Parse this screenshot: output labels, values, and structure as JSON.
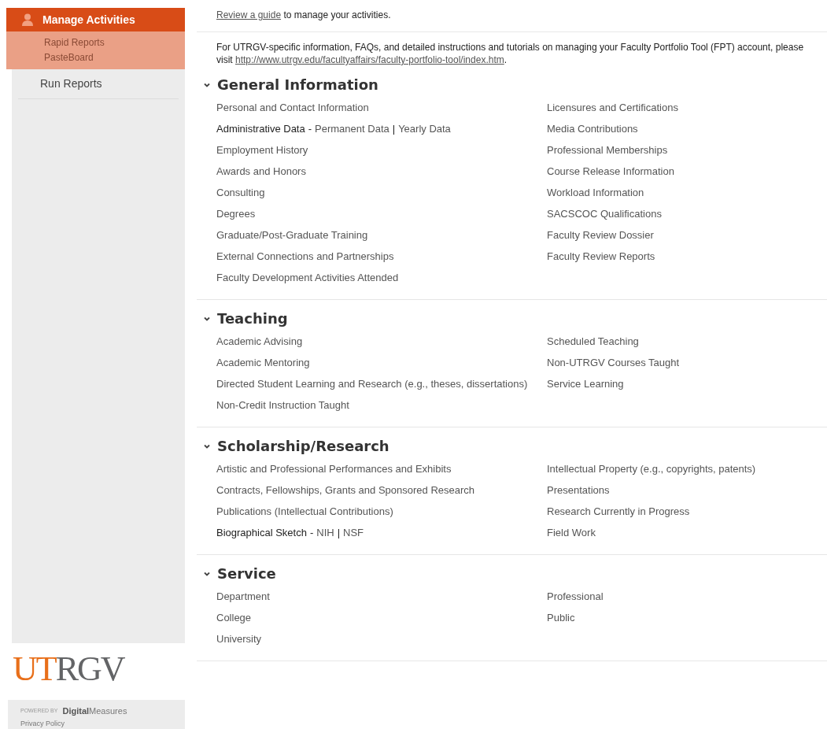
{
  "sidebar": {
    "items": [
      {
        "label": "Manage Activities",
        "selected": true,
        "children": [
          {
            "label": "Rapid Reports"
          },
          {
            "label": "PasteBoard"
          }
        ]
      },
      {
        "label": "Run Reports",
        "selected": false
      }
    ],
    "logo": {
      "primary": "UT",
      "secondary": "RGV"
    },
    "powered_by": {
      "prefix": "POWERED BY",
      "brand_bold": "Digital",
      "brand_light": "Measures"
    },
    "privacy_link": "Privacy Policy"
  },
  "intro": {
    "link": "Review a guide",
    "text": " to manage your activities."
  },
  "notice": {
    "text": "For UTRGV-specific information, FAQs, and detailed instructions and tutorials on managing your Faculty Portfolio Tool (FPT) account, please visit ",
    "link": "http://www.utrgv.edu/facultyaffairs/faculty-portfolio-tool/index.htm",
    "end": "."
  },
  "sections": [
    {
      "title": "General Information",
      "expanded": true,
      "left": [
        {
          "kind": "link",
          "label": "Personal and Contact Information"
        },
        {
          "kind": "split",
          "label": "Administrative Data",
          "dash": "-",
          "links": [
            "Permanent Data",
            "Yearly Data"
          ],
          "divider": "|"
        },
        {
          "kind": "link",
          "label": "Employment History"
        },
        {
          "kind": "link",
          "label": "Awards and Honors"
        },
        {
          "kind": "link",
          "label": "Consulting"
        },
        {
          "kind": "link",
          "label": "Degrees"
        },
        {
          "kind": "link",
          "label": "Graduate/Post-Graduate Training"
        },
        {
          "kind": "link",
          "label": "External Connections and Partnerships"
        },
        {
          "kind": "link",
          "label": "Faculty Development Activities Attended"
        }
      ],
      "right": [
        {
          "kind": "link",
          "label": "Licensures and Certifications"
        },
        {
          "kind": "link",
          "label": "Media Contributions"
        },
        {
          "kind": "link",
          "label": "Professional Memberships"
        },
        {
          "kind": "link",
          "label": "Course Release Information"
        },
        {
          "kind": "link",
          "label": "Workload Information"
        },
        {
          "kind": "link",
          "label": "SACSCOC Qualifications"
        },
        {
          "kind": "link",
          "label": "Faculty Review Dossier"
        },
        {
          "kind": "link",
          "label": "Faculty Review Reports"
        }
      ]
    },
    {
      "title": "Teaching",
      "expanded": true,
      "left": [
        {
          "kind": "link",
          "label": "Academic Advising"
        },
        {
          "kind": "link",
          "label": "Academic Mentoring"
        },
        {
          "kind": "link",
          "label": "Directed Student Learning and Research (e.g., theses, dissertations)"
        },
        {
          "kind": "link",
          "label": "Non-Credit Instruction Taught"
        }
      ],
      "right": [
        {
          "kind": "link",
          "label": "Scheduled Teaching"
        },
        {
          "kind": "link",
          "label": "Non-UTRGV Courses Taught"
        },
        {
          "kind": "link",
          "label": "Service Learning"
        }
      ]
    },
    {
      "title": "Scholarship/Research",
      "expanded": true,
      "left": [
        {
          "kind": "link",
          "label": "Artistic and Professional Performances and Exhibits"
        },
        {
          "kind": "link",
          "label": "Contracts, Fellowships, Grants and Sponsored Research"
        },
        {
          "kind": "link",
          "label": "Publications (Intellectual Contributions)"
        },
        {
          "kind": "split",
          "label": "Biographical Sketch",
          "dash": "-",
          "links": [
            "NIH",
            "NSF"
          ],
          "divider": "|"
        }
      ],
      "right": [
        {
          "kind": "link",
          "label": "Intellectual Property (e.g., copyrights, patents)"
        },
        {
          "kind": "link",
          "label": "Presentations"
        },
        {
          "kind": "link",
          "label": "Research Currently in Progress"
        },
        {
          "kind": "link",
          "label": "Field Work"
        }
      ]
    },
    {
      "title": "Service",
      "expanded": true,
      "left": [
        {
          "kind": "link",
          "label": "Department"
        },
        {
          "kind": "link",
          "label": "College"
        },
        {
          "kind": "link",
          "label": "University"
        }
      ],
      "right": [
        {
          "kind": "link",
          "label": "Professional"
        },
        {
          "kind": "link",
          "label": "Public"
        }
      ]
    }
  ]
}
